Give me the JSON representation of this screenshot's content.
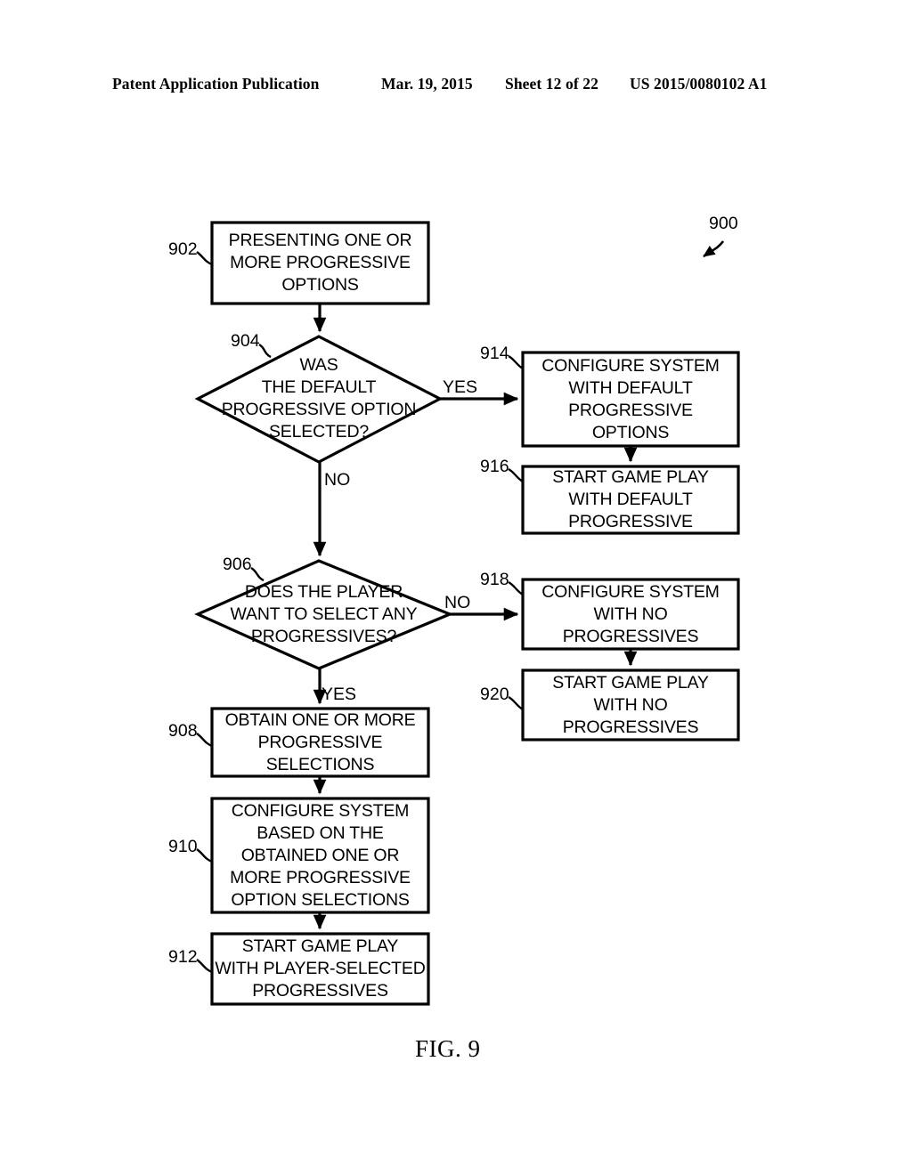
{
  "header": {
    "publication": "Patent Application Publication",
    "date": "Mar. 19, 2015",
    "sheet": "Sheet 12 of 22",
    "publication_number": "US 2015/0080102 A1"
  },
  "figure": {
    "caption": "FIG. 9",
    "diagram_reference": "900",
    "type": "flowchart",
    "nodes": [
      {
        "ref": "902",
        "shape": "process",
        "lines": [
          "PRESENTING ONE OR",
          "MORE PROGRESSIVE",
          "OPTIONS"
        ]
      },
      {
        "ref": "904",
        "shape": "decision",
        "lines": [
          "WAS",
          "THE DEFAULT",
          "PROGRESSIVE OPTION",
          "SELECTED?"
        ]
      },
      {
        "ref": "906",
        "shape": "decision",
        "lines": [
          "DOES THE PLAYER",
          "WANT TO SELECT ANY",
          "PROGRESSIVES?"
        ]
      },
      {
        "ref": "908",
        "shape": "process",
        "lines": [
          "OBTAIN ONE OR MORE",
          "PROGRESSIVE",
          "SELECTIONS"
        ]
      },
      {
        "ref": "910",
        "shape": "process",
        "lines": [
          "CONFIGURE SYSTEM",
          "BASED ON THE",
          "OBTAINED ONE OR",
          "MORE PROGRESSIVE",
          "OPTION SELECTIONS"
        ]
      },
      {
        "ref": "912",
        "shape": "process",
        "lines": [
          "START GAME PLAY",
          "WITH PLAYER-SELECTED",
          "PROGRESSIVES"
        ]
      },
      {
        "ref": "914",
        "shape": "process",
        "lines": [
          "CONFIGURE SYSTEM",
          "WITH DEFAULT",
          "PROGRESSIVE",
          "OPTIONS"
        ]
      },
      {
        "ref": "916",
        "shape": "process",
        "lines": [
          "START GAME PLAY",
          "WITH DEFAULT",
          "PROGRESSIVE"
        ]
      },
      {
        "ref": "918",
        "shape": "process",
        "lines": [
          "CONFIGURE SYSTEM",
          "WITH NO",
          "PROGRESSIVES"
        ]
      },
      {
        "ref": "920",
        "shape": "process",
        "lines": [
          "START GAME PLAY",
          "WITH NO",
          "PROGRESSIVES"
        ]
      }
    ],
    "branch_labels": {
      "yes_904": "YES",
      "no_904": "NO",
      "no_906": "NO",
      "yes_906": "YES"
    },
    "edges": [
      {
        "from": "902",
        "to": "904",
        "label": ""
      },
      {
        "from": "904",
        "to": "914",
        "label": "YES"
      },
      {
        "from": "904",
        "to": "906",
        "label": "NO"
      },
      {
        "from": "914",
        "to": "916",
        "label": ""
      },
      {
        "from": "906",
        "to": "918",
        "label": "NO"
      },
      {
        "from": "906",
        "to": "908",
        "label": "YES"
      },
      {
        "from": "918",
        "to": "920",
        "label": ""
      },
      {
        "from": "908",
        "to": "910",
        "label": ""
      },
      {
        "from": "910",
        "to": "912",
        "label": ""
      }
    ]
  },
  "colors": {
    "ink": "#000000",
    "paper": "#ffffff"
  }
}
